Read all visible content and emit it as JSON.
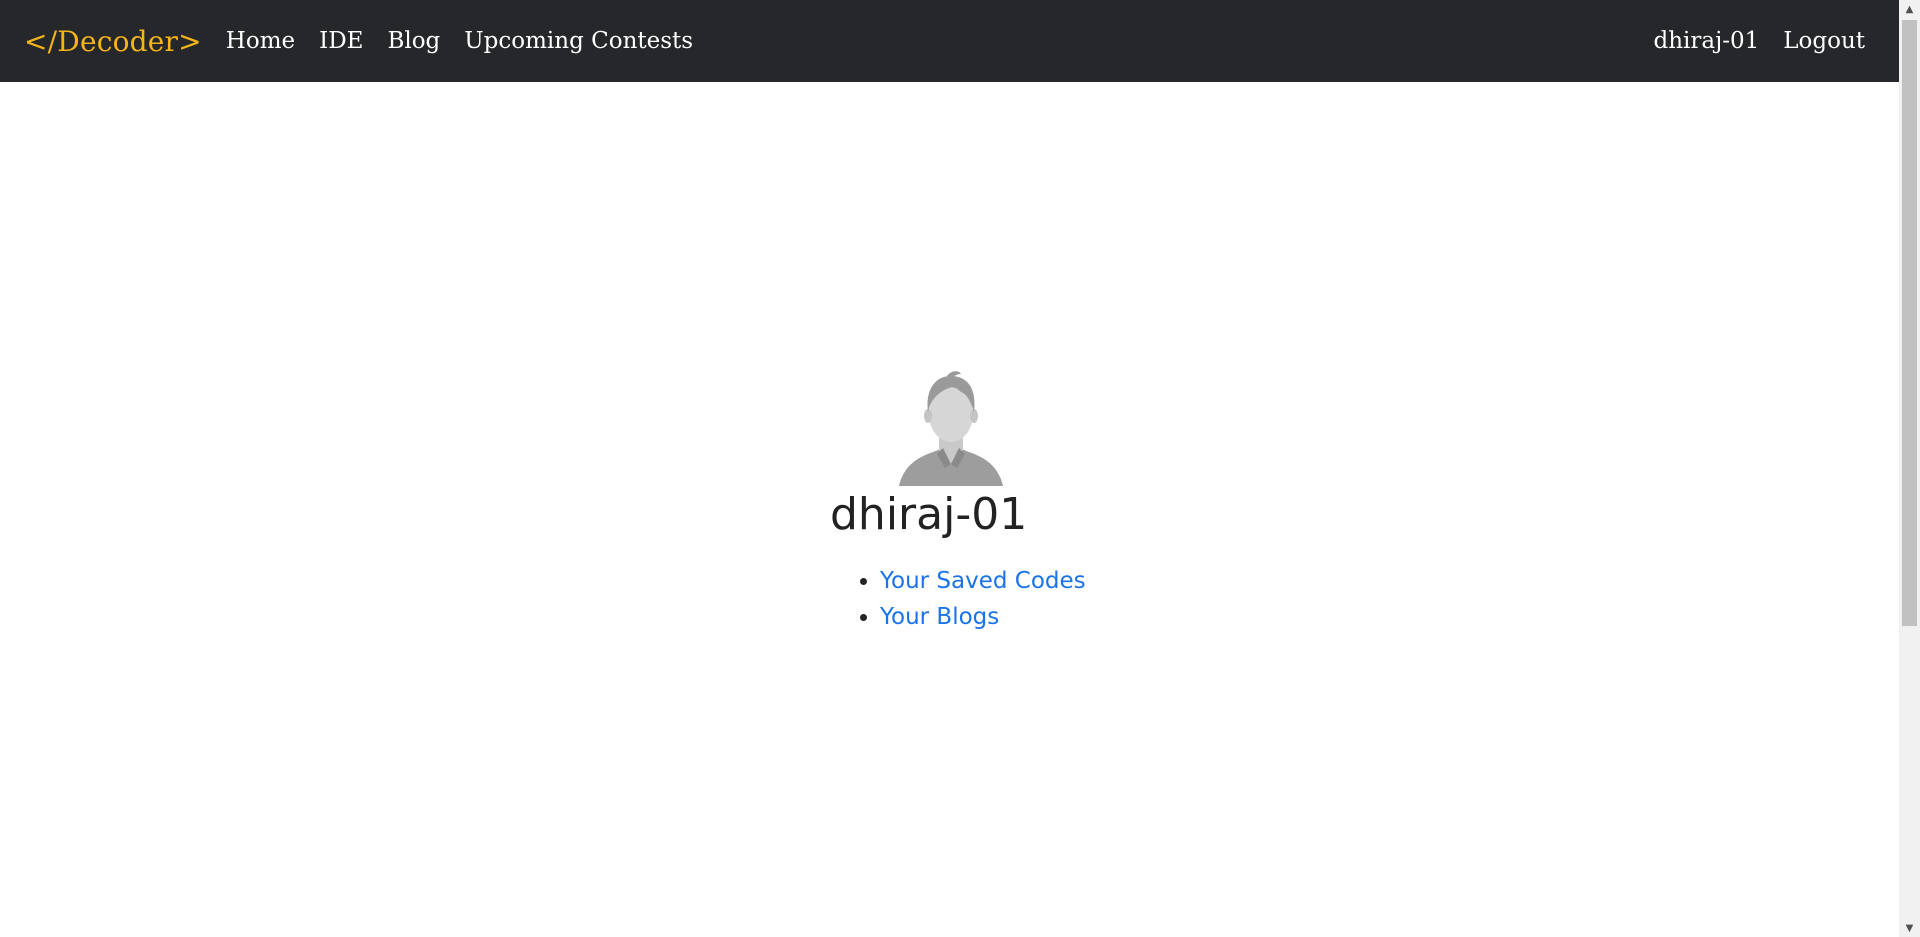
{
  "navbar": {
    "brand": "</Decoder>",
    "links": [
      {
        "label": "Home"
      },
      {
        "label": "IDE"
      },
      {
        "label": "Blog"
      },
      {
        "label": "Upcoming Contests"
      }
    ],
    "user": "dhiraj-01",
    "logout": "Logout",
    "colors": {
      "background": "#25272b",
      "brand": "#f4b41a",
      "link": "#ffffff"
    }
  },
  "profile": {
    "avatar_icon": "user-avatar-icon",
    "username": "dhiraj-01",
    "links": [
      {
        "label": "Your Saved Codes"
      },
      {
        "label": "Your Blogs"
      }
    ],
    "colors": {
      "link": "#1a73e8"
    }
  },
  "scrollbar": {
    "up_icon": "scroll-up-arrow-icon",
    "down_icon": "scroll-down-arrow-icon"
  }
}
